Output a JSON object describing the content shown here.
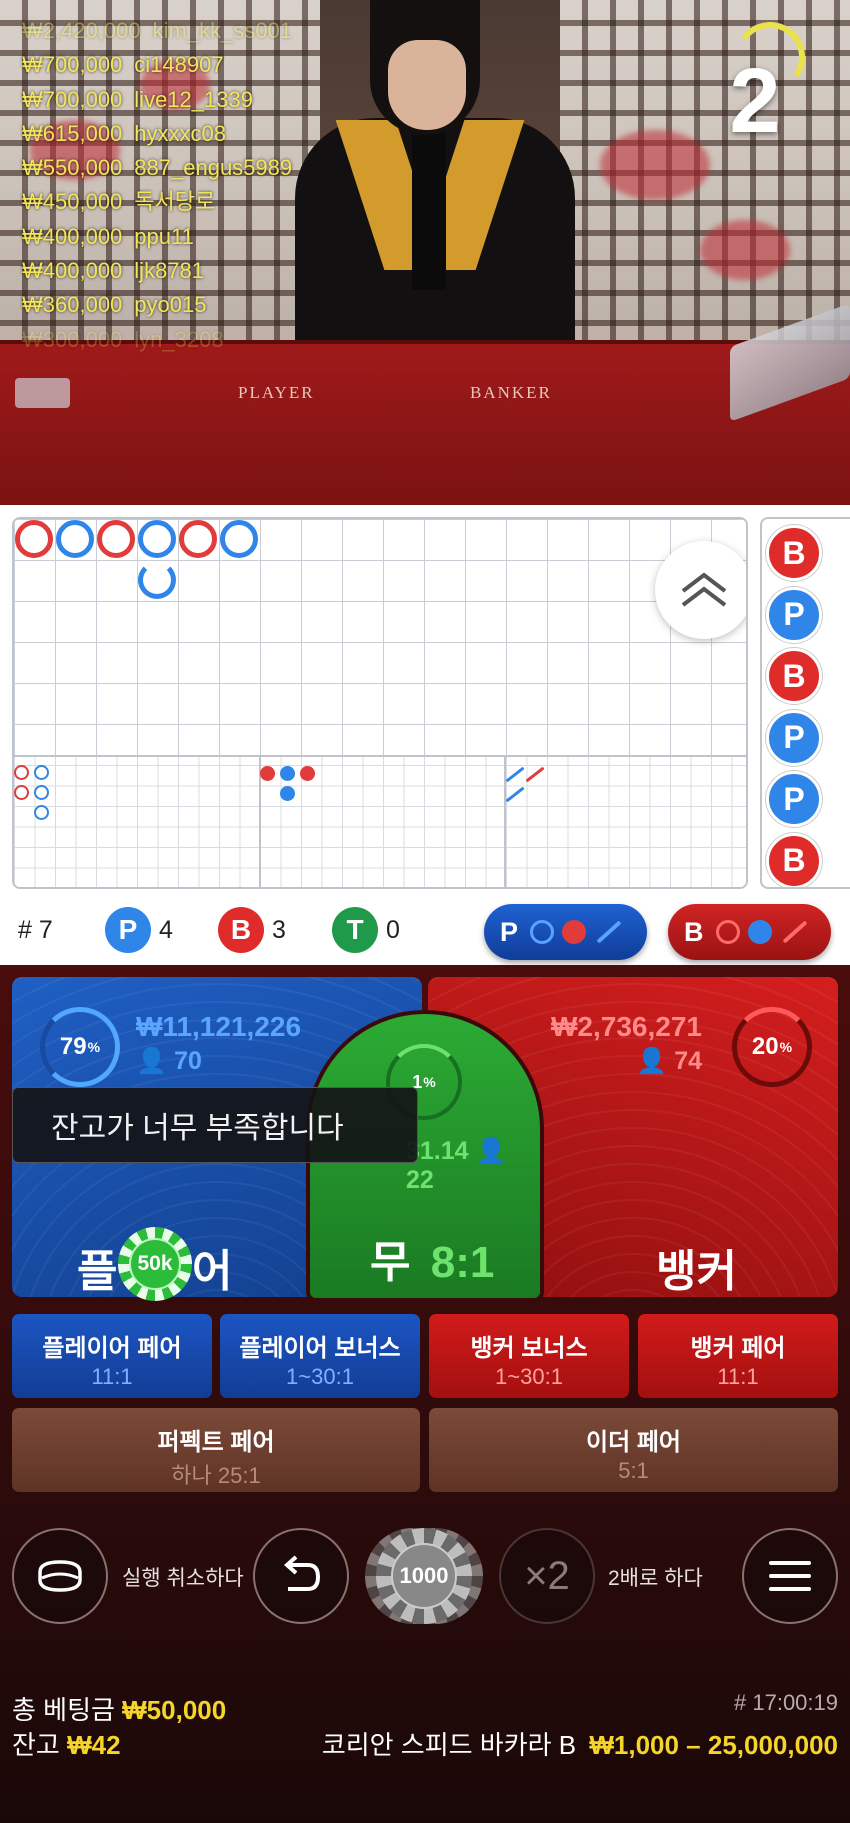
{
  "stream": {
    "countdown": "2",
    "winners": [
      {
        "amount": "₩2,420,000",
        "name": "kim_kk_ss001"
      },
      {
        "amount": "₩700,000",
        "name": "ci148907"
      },
      {
        "amount": "₩700,000",
        "name": "live12_1339"
      },
      {
        "amount": "₩615,000",
        "name": "hyxxxc08"
      },
      {
        "amount": "₩550,000",
        "name": "887_engus5989"
      },
      {
        "amount": "₩450,000",
        "name": "독서당로"
      },
      {
        "amount": "₩400,000",
        "name": "ppu11"
      },
      {
        "amount": "₩400,000",
        "name": "ljk8781"
      },
      {
        "amount": "₩360,000",
        "name": "pyo015"
      },
      {
        "amount": "₩300,000",
        "name": "lyn_3208"
      }
    ],
    "table_labels": {
      "player": "PLAYER",
      "banker": "BANKER"
    }
  },
  "roadmap": {
    "bead_road": [
      "B",
      "P",
      "B",
      "P",
      "B",
      "P"
    ],
    "side_road": [
      "B",
      "P",
      "B",
      "P",
      "P",
      "B"
    ],
    "stats": {
      "hash": "# 7",
      "p_letter": "P",
      "p_count": "4",
      "b_letter": "B",
      "b_count": "3",
      "t_letter": "T",
      "t_count": "0"
    },
    "predict_player": {
      "letter": "P"
    },
    "predict_banker": {
      "letter": "B"
    },
    "colors": {
      "player": "#2f86e8",
      "banker": "#e23b3b",
      "tie": "#1f9a4a"
    }
  },
  "bets": {
    "player": {
      "percent": "79",
      "percent_sign": "%",
      "amount": "₩11,121,226",
      "count": "70",
      "title_a": "플",
      "title_b": "어",
      "odds": ""
    },
    "banker": {
      "percent": "20",
      "percent_sign": "%",
      "amount": "₩2,736,271",
      "count": "74",
      "title": "뱅커"
    },
    "tie": {
      "percent": "1",
      "percent_sign": "%",
      "amount_partial": "31.14",
      "count": "22",
      "title": "무",
      "odds": "8:1"
    },
    "placed_chip": "50k",
    "tooltip": "잔고가 너무 부족합니다",
    "side_bets": [
      {
        "title": "플레이어 페어",
        "odds": "11:1"
      },
      {
        "title": "플레이어 보너스",
        "odds": "1~30:1"
      },
      {
        "title": "뱅커 보너스",
        "odds": "1~30:1"
      },
      {
        "title": "뱅커 페어",
        "odds": "11:1"
      }
    ],
    "extra_bets": [
      {
        "title": "퍼펙트 페어",
        "odds": "하나 25:1"
      },
      {
        "title": "이더 페어",
        "odds": "5:1"
      }
    ]
  },
  "controls": {
    "undo_label": "실행 취소하다",
    "chip_value": "1000",
    "double_symbol": "×2",
    "double_label": "2배로 하다"
  },
  "footer": {
    "total_bet_label": "총 베팅금",
    "total_bet_value": "₩50,000",
    "balance_label": "잔고",
    "balance_value": "₩42",
    "round_id": "# 17:00:19",
    "table_name": "코리안 스피드 바카라 B",
    "limits": "₩1,000 – 25,000,000"
  }
}
